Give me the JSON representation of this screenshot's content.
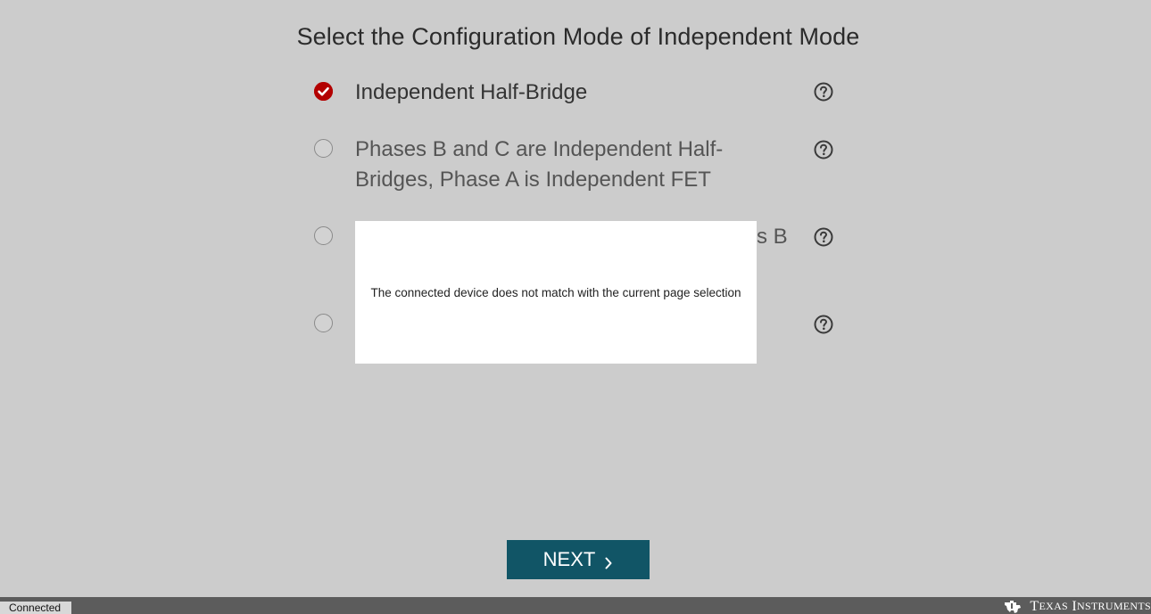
{
  "page": {
    "title": "Select the Configuration Mode of Independent Mode"
  },
  "options": [
    {
      "label": "Independent Half-Bridge",
      "selected": true
    },
    {
      "label": "Phases B and C are Independent Half-Bridges, Phase A is Independent FET",
      "selected": false
    },
    {
      "label": "s B",
      "selected": false
    },
    {
      "label": "",
      "selected": false
    }
  ],
  "dialog": {
    "message": "The connected device does not match with the current page selection"
  },
  "next_button": {
    "label": "NEXT"
  },
  "status_bar": {
    "status": "Connected",
    "brand_first_initial": "T",
    "brand_first_rest": "EXAS",
    "brand_second_initial": "I",
    "brand_second_rest": "NSTRUMENTS"
  },
  "colors": {
    "background": "#cccccc",
    "accent_selected": "#b30000",
    "button": "#115566",
    "footer": "#5c5c5c"
  },
  "icons": [
    "check-circle-icon",
    "radio-icon",
    "help-icon",
    "chevron-right-icon",
    "ti-logo-icon"
  ]
}
